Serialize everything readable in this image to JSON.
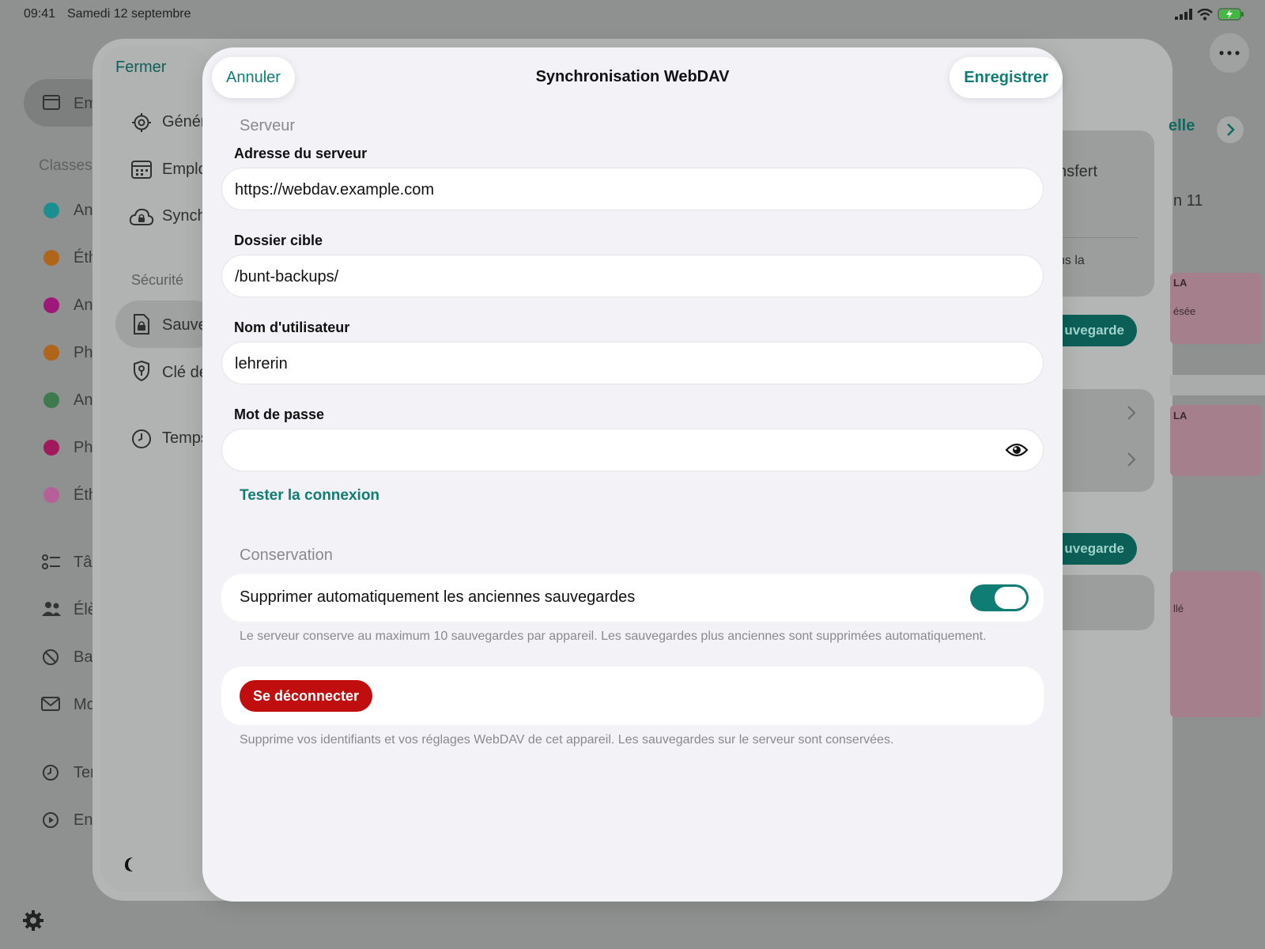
{
  "status_bar": {
    "time": "09:41",
    "date": "Samedi 12 septembre"
  },
  "background": {
    "sidebar_selected": "Em",
    "classes_header": "Classes",
    "classes": [
      {
        "label": "An",
        "color": "#1b8f90"
      },
      {
        "label": "Éth",
        "color": "#b0651a"
      },
      {
        "label": "An",
        "color": "#a0177a"
      },
      {
        "label": "Ph",
        "color": "#b0651a"
      },
      {
        "label": "An",
        "color": "#3e7a4e"
      },
      {
        "label": "Ph",
        "color": "#a0195d"
      },
      {
        "label": "Éth",
        "color": "#b75f99"
      }
    ],
    "nav_items": [
      {
        "label": "Tâ",
        "icon": "checklist-icon"
      },
      {
        "label": "Élè",
        "icon": "people-icon"
      },
      {
        "label": "Ba",
        "icon": "no-entry-icon"
      },
      {
        "label": "Mo",
        "icon": "mail-icon"
      },
      {
        "label": "Ter",
        "icon": "clock-icon"
      },
      {
        "label": "En",
        "icon": "play-circle-icon"
      }
    ],
    "right_fragments": {
      "nav_link": "elle",
      "transfer": "nsfert",
      "number": "n 11",
      "text_la": "ns la",
      "pill_1": "uvegarde",
      "pill_2": "uvegarde",
      "badge_1": "LA",
      "badge_1_sub": "ésée",
      "badge_2": "LA",
      "badge_3_sub": "llé"
    }
  },
  "settings": {
    "close_label": "Fermer",
    "items": [
      {
        "label": "Génér",
        "icon": "gear-icon"
      },
      {
        "label": "Emplo",
        "icon": "calendar-icon"
      },
      {
        "label": "Synch",
        "icon": "cloud-lock-icon"
      }
    ],
    "security_header": "Sécurité",
    "security_items": [
      {
        "label": "Sauve",
        "icon": "document-lock-icon"
      },
      {
        "label": "Clé de",
        "icon": "key-shield-icon"
      }
    ],
    "time_item": {
      "label": "Temps",
      "icon": "clock-icon"
    }
  },
  "modal": {
    "title": "Synchronisation WebDAV",
    "cancel_label": "Annuler",
    "save_label": "Enregistrer",
    "server_section": "Serveur",
    "server_address_label": "Adresse du serveur",
    "server_address_value": "https://webdav.example.com",
    "target_folder_label": "Dossier cible",
    "target_folder_value": "/bunt-backups/",
    "username_label": "Nom d'utilisateur",
    "username_value": "lehrerin",
    "password_label": "Mot de passe",
    "password_value": "",
    "test_connection_label": "Tester la connexion",
    "retention_section": "Conservation",
    "auto_delete_label": "Supprimer automatiquement les anciennes sauvegardes",
    "auto_delete_enabled": true,
    "retention_note": "Le serveur conserve au maximum 10 sauvegardes par appareil. Les sauvegardes plus anciennes sont supprimées automatiquement.",
    "logout_label": "Se déconnecter",
    "logout_note": "Supprime vos identifiants et vos réglages WebDAV de cet appareil. Les sauvegardes sur le serveur sont conservées."
  }
}
